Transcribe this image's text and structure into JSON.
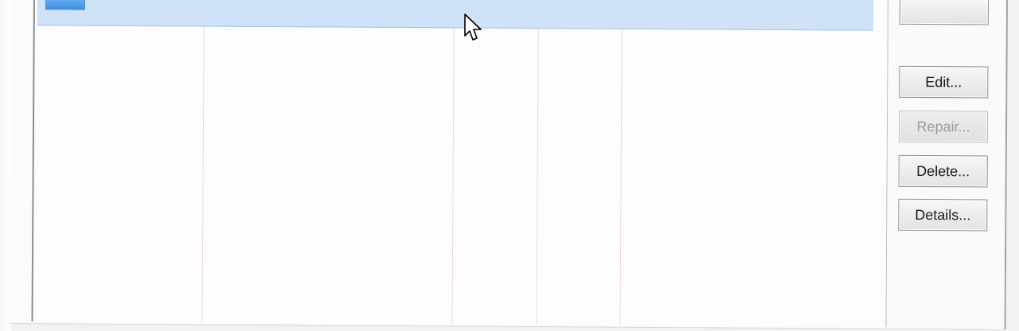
{
  "window": {
    "title": "",
    "list": {
      "selected_row": {
        "name": "",
        "type": "",
        "detail": ""
      }
    },
    "buttons": {
      "partial_label": "",
      "edit_label": "Edit...",
      "repair_label": "Repair...",
      "delete_label": "Delete...",
      "details_label": "Details..."
    }
  },
  "icons": {
    "row_icon": "connection-icon",
    "cursor": "mouse-pointer-icon"
  },
  "colors": {
    "selection": "#cfe2f7",
    "selection_border": "#9fc4ec",
    "button_border": "#8e8e8e",
    "disabled_text": "#9b9b9b",
    "column_line": "#f1d8d8"
  }
}
